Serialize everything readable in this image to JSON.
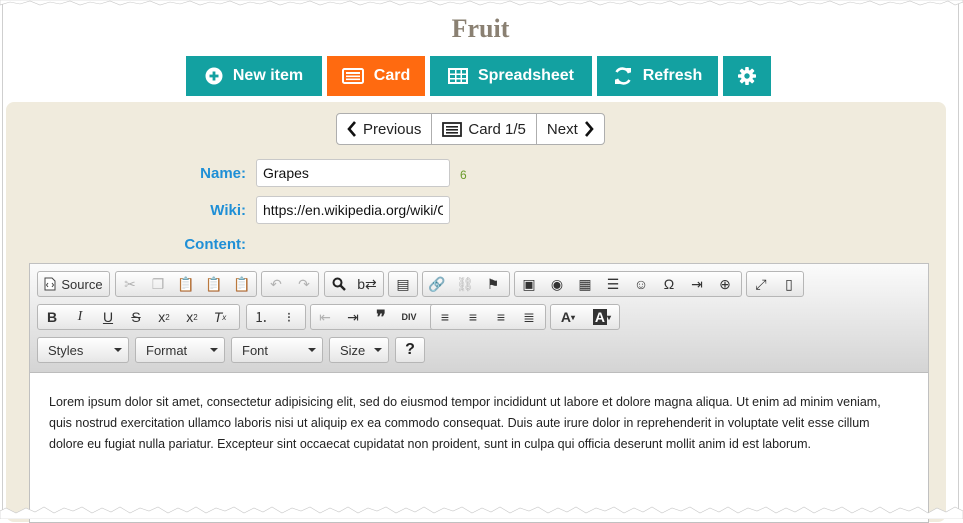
{
  "page": {
    "title": "Fruit"
  },
  "actions": {
    "new_item": "New item",
    "card": "Card",
    "spreadsheet": "Spreadsheet",
    "refresh": "Refresh"
  },
  "pager": {
    "previous": "Previous",
    "card": "Card 1/5",
    "next": "Next"
  },
  "form": {
    "name_label": "Name:",
    "name_value": "Grapes",
    "name_count": "6",
    "wiki_label": "Wiki:",
    "wiki_value": "https://en.wikipedia.org/wiki/Grape",
    "content_label": "Content:"
  },
  "editor": {
    "source_label": "Source",
    "styles_label": "Styles",
    "format_label": "Format",
    "font_label": "Font",
    "size_label": "Size",
    "help_label": "?",
    "content": "Lorem ipsum dolor sit amet, consectetur adipisicing elit, sed do eiusmod tempor incididunt ut labore et dolore magna aliqua. Ut enim ad minim veniam, quis nostrud exercitation ullamco laboris nisi ut aliquip ex ea commodo consequat. Duis aute irure dolor in reprehenderit in voluptate velit esse cillum dolore eu fugiat nulla pariatur. Excepteur sint occaecat cupidatat non proident, sunt in culpa qui officia deserunt mollit anim id est laborum."
  },
  "colors": {
    "teal": "#13a1a1",
    "orange": "#ff6a10",
    "label_blue": "#1f8fd6",
    "panel_beige": "#f0ebdd",
    "title_brown": "#8a8072"
  },
  "icons": [
    "plus-circle-icon",
    "card-icon",
    "table-icon",
    "refresh-icon",
    "gear-icon",
    "chevron-left-icon",
    "chevron-right-icon"
  ]
}
